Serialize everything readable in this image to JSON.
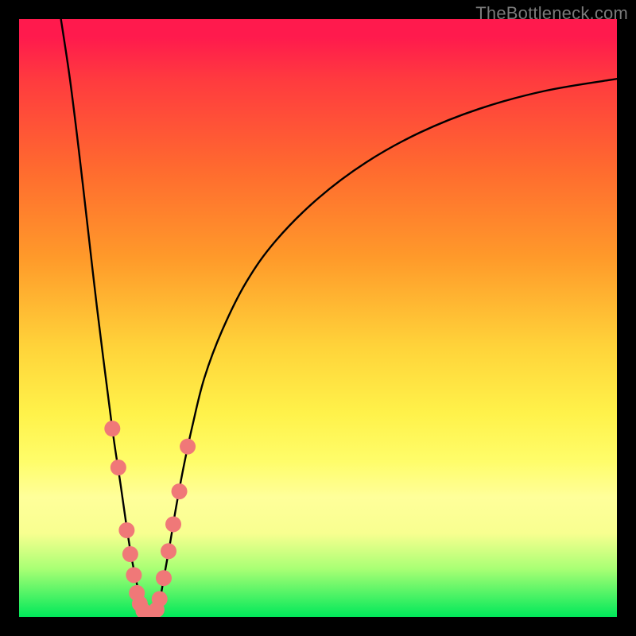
{
  "watermark": "TheBottleneck.com",
  "chart_data": {
    "type": "line",
    "title": "",
    "xlabel": "",
    "ylabel": "",
    "xlim": [
      0,
      100
    ],
    "ylim": [
      0,
      100
    ],
    "grid": false,
    "left_curve": {
      "x": [
        7.0,
        8.5,
        10.0,
        11.5,
        13.0,
        14.5,
        15.8,
        17.0,
        18.0,
        18.8,
        19.6,
        20.3,
        21.0
      ],
      "y": [
        100,
        90,
        78,
        65,
        52,
        40,
        30,
        22,
        15,
        10,
        6,
        3,
        0
      ]
    },
    "right_curve": {
      "x": [
        23.0,
        23.6,
        24.3,
        25.2,
        26.2,
        27.5,
        29.0,
        31.0,
        34.0,
        38.0,
        43.0,
        50.0,
        58.0,
        67.0,
        77.0,
        88.0,
        100.0
      ],
      "y": [
        0,
        3,
        7,
        12,
        18,
        25,
        32,
        40,
        48,
        56,
        63,
        70,
        76,
        81,
        85,
        88,
        90
      ]
    },
    "markers": [
      {
        "x": 15.6,
        "y": 31.5
      },
      {
        "x": 16.6,
        "y": 25.0
      },
      {
        "x": 18.0,
        "y": 14.5
      },
      {
        "x": 18.6,
        "y": 10.5
      },
      {
        "x": 19.2,
        "y": 7.0
      },
      {
        "x": 19.7,
        "y": 4.0
      },
      {
        "x": 20.2,
        "y": 2.2
      },
      {
        "x": 20.8,
        "y": 1.0
      },
      {
        "x": 21.5,
        "y": 0.5
      },
      {
        "x": 22.3,
        "y": 0.5
      },
      {
        "x": 23.0,
        "y": 1.2
      },
      {
        "x": 23.5,
        "y": 3.0
      },
      {
        "x": 24.2,
        "y": 6.5
      },
      {
        "x": 25.0,
        "y": 11.0
      },
      {
        "x": 25.8,
        "y": 15.5
      },
      {
        "x": 26.8,
        "y": 21.0
      },
      {
        "x": 28.2,
        "y": 28.5
      }
    ],
    "marker_color": "#f07878",
    "curve_color": "#000000",
    "curve_width": 2.4,
    "marker_radius": 10
  }
}
